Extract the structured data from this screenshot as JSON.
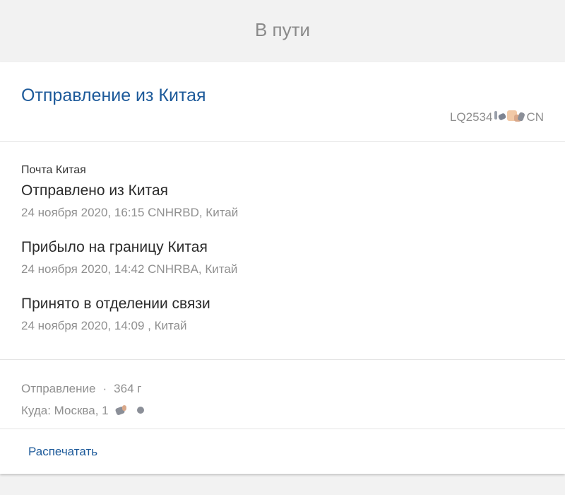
{
  "status": {
    "title": "В пути"
  },
  "shipment": {
    "title": "Отправление из Китая",
    "tracking_prefix": "LQ2534",
    "tracking_suffix": "CN"
  },
  "events": {
    "carrier": "Почта Китая",
    "items": [
      {
        "name": "Отправлено из Китая",
        "meta": "24 ноября 2020, 16:15 CNHRBD, Китай"
      },
      {
        "name": "Прибыло на границу Китая",
        "meta": "24 ноября 2020, 14:42 CNHRBA, Китай"
      },
      {
        "name": "Принято в отделении связи",
        "meta": "24 ноября 2020, 14:09 , Китай"
      }
    ]
  },
  "info": {
    "type": "Отправление",
    "separator": "·",
    "weight": "364 г",
    "destination": "Куда: Москва, 1"
  },
  "actions": {
    "print_label": "Распечатать"
  }
}
